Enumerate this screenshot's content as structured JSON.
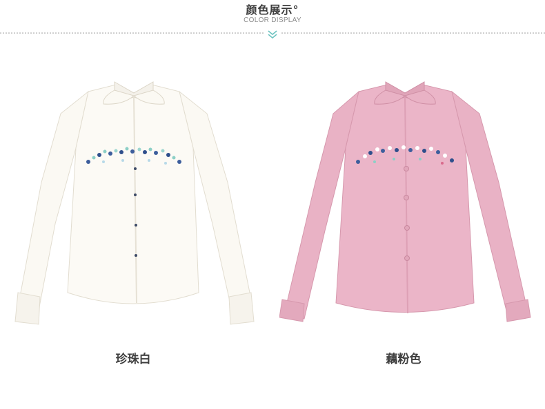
{
  "header": {
    "title": "颜色展示°",
    "subtitle": "COLOR DISPLAY",
    "chevron_icon": "double-chevron-down-icon",
    "accent_color": "#6cc3c0"
  },
  "products": [
    {
      "color_name": "珍珠白",
      "shirt_color": "#fbf9f3",
      "image_icon": "white-shirt-image"
    },
    {
      "color_name": "藕粉色",
      "shirt_color": "#e9b2c5",
      "image_icon": "pink-shirt-image"
    }
  ]
}
